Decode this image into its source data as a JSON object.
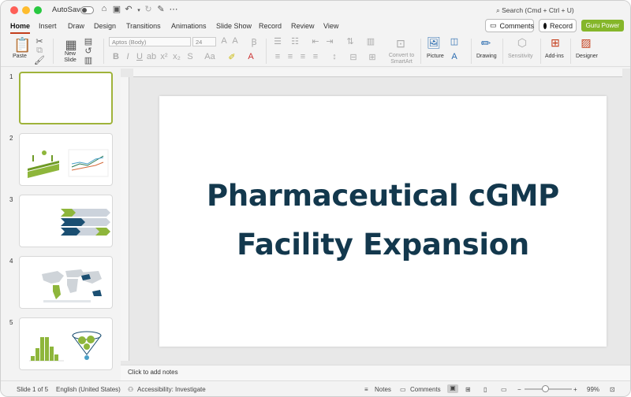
{
  "titlebar": {
    "autosave_label": "AutoSave",
    "search_placeholder": "Search (Cmd + Ctrl + U)"
  },
  "tabs": [
    "Home",
    "Insert",
    "Draw",
    "Design",
    "Transitions",
    "Animations",
    "Slide Show",
    "Record",
    "Review",
    "View"
  ],
  "top_buttons": {
    "comments": "Comments",
    "record": "Record",
    "guru": "Guru Power"
  },
  "ribbon": {
    "paste": "Paste",
    "new_slide": "New Slide",
    "font_name": "Aptos (Body)",
    "font_size": "24",
    "convert_smartart": "Convert to SmartArt",
    "picture": "Picture",
    "drawing": "Drawing",
    "sensitivity": "Sensitivity",
    "addins": "Add-ins",
    "designer": "Designer"
  },
  "thumbnails": [
    "1",
    "2",
    "3",
    "4",
    "5"
  ],
  "slide": {
    "title_line1": "Pharmaceutical cGMP",
    "title_line2": "Facility Expansion"
  },
  "notes_placeholder": "Click to add notes",
  "status": {
    "slide_count": "Slide 1 of 5",
    "language": "English (United States)",
    "accessibility": "Accessibility: Investigate",
    "notes": "Notes",
    "comments": "Comments",
    "zoom": "99%"
  },
  "colors": {
    "accent": "#c43e1c",
    "guru": "#85b62a",
    "title": "#13384d",
    "selection": "#9fb33a"
  }
}
